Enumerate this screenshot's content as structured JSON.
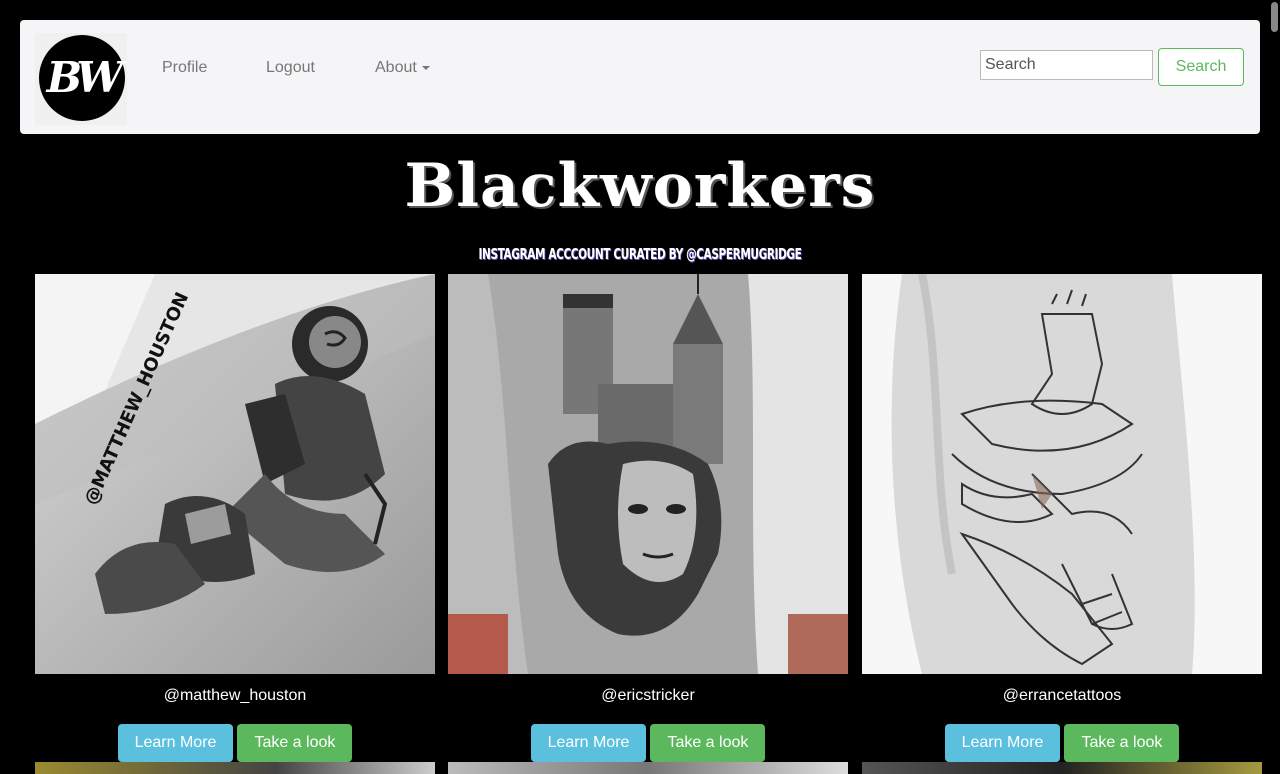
{
  "nav": {
    "logo_text": "BW",
    "links": [
      {
        "label": "Profile"
      },
      {
        "label": "Logout"
      },
      {
        "label": "About"
      }
    ],
    "search": {
      "placeholder": "Search",
      "value": ""
    },
    "search_button": "Search"
  },
  "header": {
    "title": "Blackworkers",
    "subtitle": "Instagram acccount curated by @caspermugridge"
  },
  "cards": [
    {
      "handle": "@matthew_houston",
      "learn_more": "Learn More",
      "take_a_look": "Take a look",
      "watermark": "@MATTHEW_HOUSTON"
    },
    {
      "handle": "@ericstricker",
      "learn_more": "Learn More",
      "take_a_look": "Take a look"
    },
    {
      "handle": "@errancetattoos",
      "learn_more": "Learn More",
      "take_a_look": "Take a look"
    }
  ],
  "colors": {
    "info": "#5bc0de",
    "success": "#5cb85c",
    "navbar_bg": "#f5f5f7",
    "page_bg": "#000000"
  }
}
